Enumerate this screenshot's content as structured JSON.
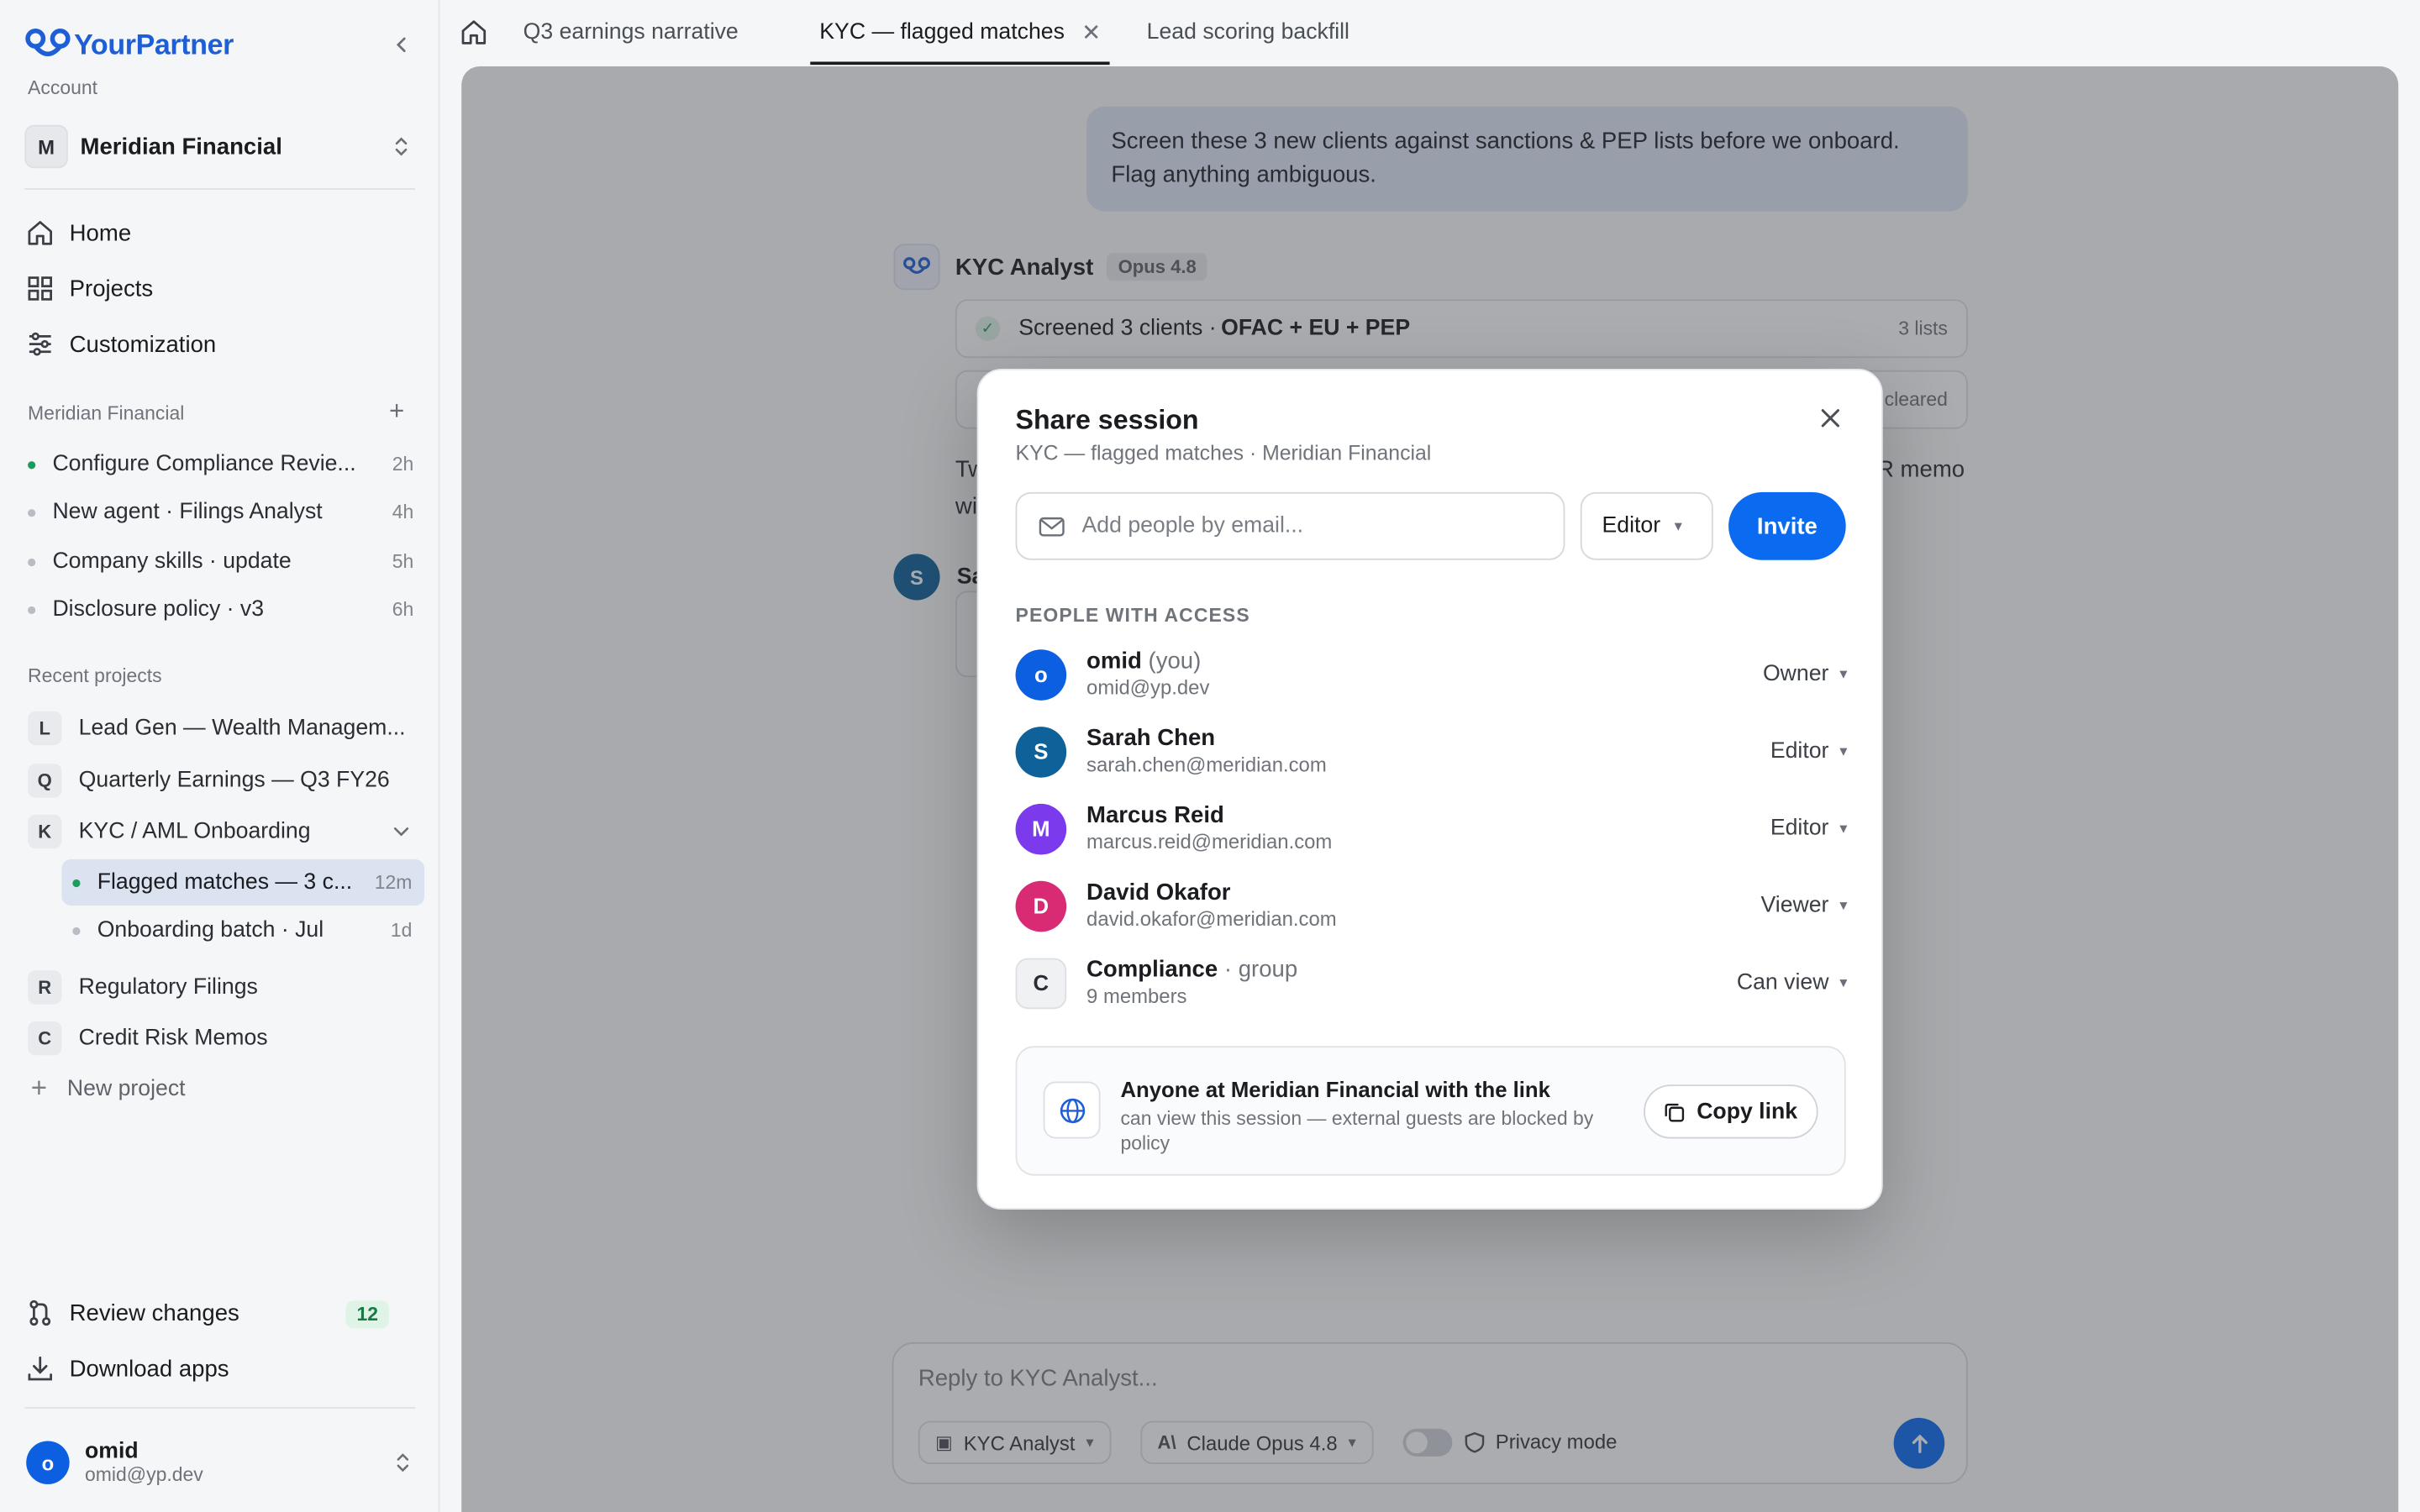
{
  "app": {
    "name": "YourPartner"
  },
  "sidebar": {
    "account_label": "Account",
    "account": {
      "initial": "M",
      "name": "Meridian Financial"
    },
    "nav": [
      {
        "label": "Home",
        "icon": "home-icon"
      },
      {
        "label": "Projects",
        "icon": "grid-icon"
      },
      {
        "label": "Customization",
        "icon": "sliders-icon"
      }
    ],
    "workspace_label": "Meridian Financial",
    "sessions": [
      {
        "label": "Configure Compliance Revie...",
        "time": "2h",
        "active": true
      },
      {
        "label": "New agent · Filings Analyst",
        "time": "4h"
      },
      {
        "label": "Company skills · update",
        "time": "5h"
      },
      {
        "label": "Disclosure policy · v3",
        "time": "6h"
      }
    ],
    "recent_label": "Recent projects",
    "projects": [
      {
        "initial": "L",
        "label": "Lead Gen — Wealth Managem..."
      },
      {
        "initial": "Q",
        "label": "Quarterly Earnings — Q3 FY26"
      },
      {
        "initial": "K",
        "label": "KYC / AML Onboarding"
      },
      {
        "initial": "R",
        "label": "Regulatory Filings"
      },
      {
        "initial": "C",
        "label": "Credit Risk Memos"
      }
    ],
    "subitems": [
      {
        "label": "Flagged matches — 3 c...",
        "time": "12m"
      },
      {
        "label": "Onboarding batch · Jul",
        "time": "1d"
      }
    ],
    "new_project": "New project",
    "review_changes": "Review changes",
    "review_count": "12",
    "download_apps": "Download apps",
    "user": {
      "initial": "o",
      "name": "omid",
      "email": "omid@yp.dev"
    }
  },
  "tabs": [
    {
      "label": "Q3 earnings narrative"
    },
    {
      "label": "KYC — flagged matches",
      "active": true
    },
    {
      "label": "Lead scoring backfill"
    }
  ],
  "chat": {
    "user_message": "Screen these 3 new clients against sanctions & PEP lists before we onboard. Flag anything ambiguous.",
    "agent_name": "KYC Analyst",
    "model": "Opus 4.8",
    "tool1": {
      "label": "Screened 3 clients · ",
      "bold": "OFAC + EU + PEP",
      "right": "3 lists"
    },
    "tool2_right": "cleared",
    "text_prefix": "Tw",
    "text_suffix": "R memo",
    "text_line2": "wi",
    "sarah_initial": "S",
    "sarah_name_partial": "Sa",
    "reply_placeholder": "Reply to KYC Analyst...",
    "agent_pill": "KYC Analyst",
    "model_pill": "Claude Opus 4.8",
    "privacy": "Privacy mode"
  },
  "modal": {
    "title": "Share session",
    "subtitle": "KYC — flagged matches · Meridian Financial",
    "email_placeholder": "Add people by email...",
    "role": "Editor",
    "invite": "Invite",
    "people_label": "PEOPLE WITH ACCESS",
    "people": [
      {
        "initial": "o",
        "name": "omid",
        "suffix": " (you)",
        "email": "omid@yp.dev",
        "role": "Owner",
        "color": "#0b5fe0"
      },
      {
        "initial": "S",
        "name": "Sarah Chen",
        "suffix": "",
        "email": "sarah.chen@meridian.com",
        "role": "Editor",
        "color": "#0e6199"
      },
      {
        "initial": "M",
        "name": "Marcus Reid",
        "suffix": "",
        "email": "marcus.reid@meridian.com",
        "role": "Editor",
        "color": "#7c3aed"
      },
      {
        "initial": "D",
        "name": "David Okafor",
        "suffix": "",
        "email": "david.okafor@meridian.com",
        "role": "Viewer",
        "color": "#d92a74"
      },
      {
        "initial": "C",
        "name": "Compliance",
        "suffix": " · group",
        "email": "9 members",
        "role": "Can view",
        "color": "#f0f1f3"
      }
    ],
    "link": {
      "title": "Anyone at Meridian Financial with the link",
      "desc": "can view this session — external guests are blocked by policy",
      "copy": "Copy link"
    }
  },
  "colors": {
    "accent": "#0b6bf0",
    "brand": "#1f5fd6",
    "success": "#1d9d5d"
  }
}
